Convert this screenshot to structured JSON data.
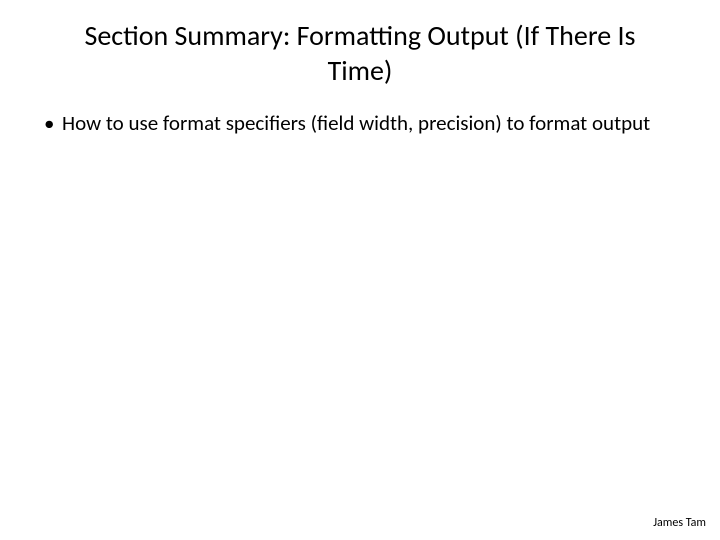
{
  "slide": {
    "title": "Section Summary: Formatting Output  (If There Is Time)",
    "bullets": [
      "How to use format specifiers (field width, precision) to format output"
    ],
    "footer": "James Tam"
  }
}
